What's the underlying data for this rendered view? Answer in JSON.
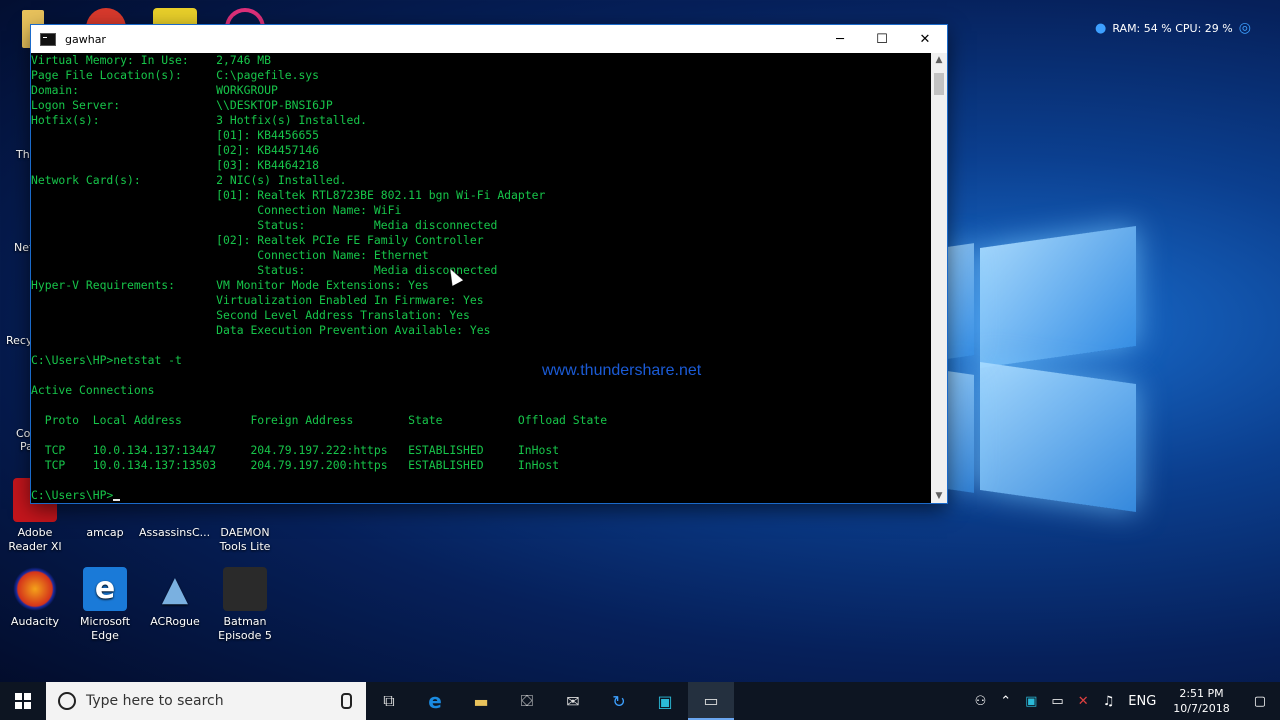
{
  "system_overlay": {
    "stats": "RAM: 54 % CPU: 29 %"
  },
  "desktop": {
    "partial_labels": [
      "Thi",
      "Net",
      "Recy",
      "Co",
      "Pa"
    ],
    "icons": [
      {
        "label": "Adobe Reader XI"
      },
      {
        "label": "amcap"
      },
      {
        "label": "AssassinsC..."
      },
      {
        "label": "DAEMON Tools Lite"
      },
      {
        "label": "Audacity"
      },
      {
        "label": "Microsoft Edge"
      },
      {
        "label": "ACRogue"
      },
      {
        "label": "Batman Episode 5"
      }
    ]
  },
  "window": {
    "title": "gawhar",
    "controls": {
      "minimize": "─",
      "maximize": "☐",
      "close": "✕"
    },
    "lines": [
      "Virtual Memory: In Use:    2,746 MB",
      "Page File Location(s):     C:\\pagefile.sys",
      "Domain:                    WORKGROUP",
      "Logon Server:              \\\\DESKTOP-BNSI6JP",
      "Hotfix(s):                 3 Hotfix(s) Installed.",
      "                           [01]: KB4456655",
      "                           [02]: KB4457146",
      "                           [03]: KB4464218",
      "Network Card(s):           2 NIC(s) Installed.",
      "                           [01]: Realtek RTL8723BE 802.11 bgn Wi-Fi Adapter",
      "                                 Connection Name: WiFi",
      "                                 Status:          Media disconnected",
      "                           [02]: Realtek PCIe FE Family Controller",
      "                                 Connection Name: Ethernet",
      "                                 Status:          Media disconnected",
      "Hyper-V Requirements:      VM Monitor Mode Extensions: Yes",
      "                           Virtualization Enabled In Firmware: Yes",
      "                           Second Level Address Translation: Yes",
      "                           Data Execution Prevention Available: Yes",
      "",
      "C:\\Users\\HP>netstat -t",
      "",
      "Active Connections",
      "",
      "  Proto  Local Address          Foreign Address        State           Offload State",
      "",
      "  TCP    10.0.134.137:13447     204.79.197.222:https   ESTABLISHED     InHost",
      "  TCP    10.0.134.137:13503     204.79.197.200:https   ESTABLISHED     InHost",
      "",
      "C:\\Users\\HP>"
    ],
    "watermark": "www.thundershare.net"
  },
  "taskbar": {
    "search_placeholder": "Type here to search",
    "language": "ENG",
    "time": "2:51 PM",
    "date": "10/7/2018"
  }
}
